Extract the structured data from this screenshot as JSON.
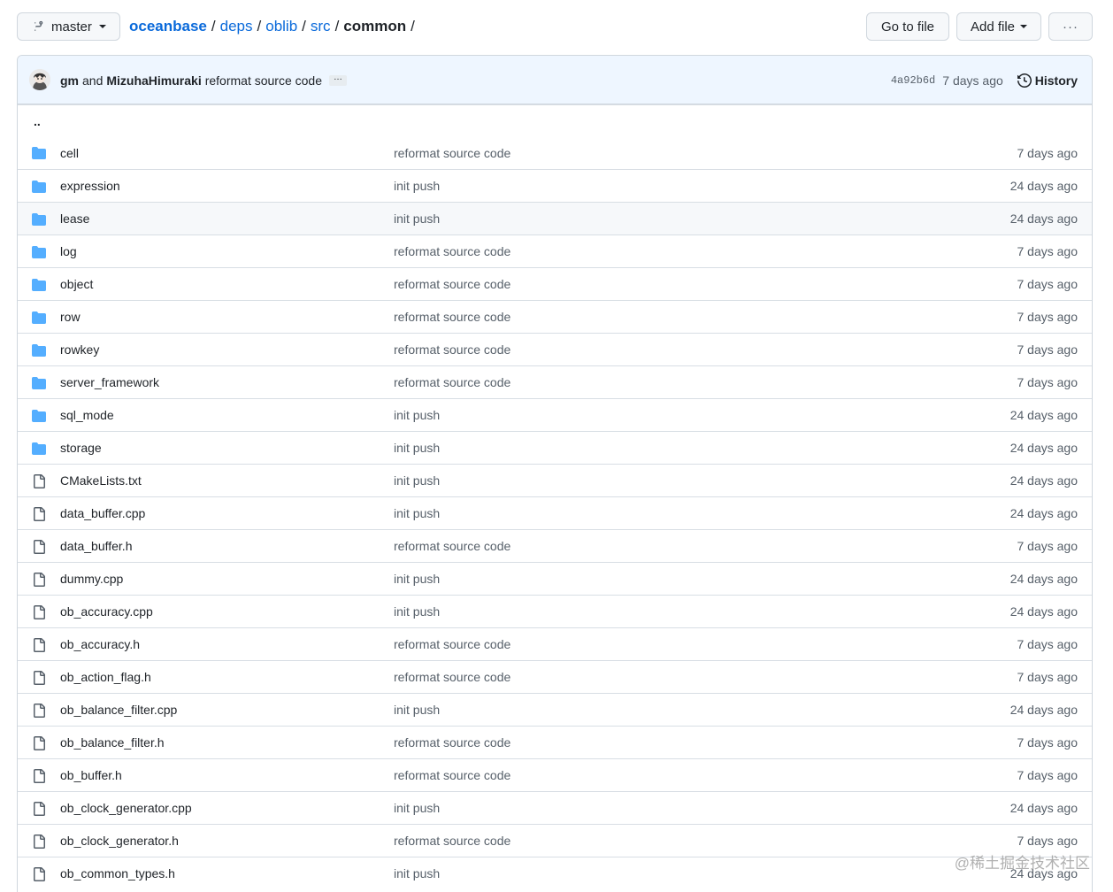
{
  "toolbar": {
    "branch": "master",
    "breadcrumb": {
      "repo": "oceanbase",
      "parts": [
        "deps",
        "oblib",
        "src"
      ],
      "current": "common",
      "sep": "/"
    },
    "goto_label": "Go to file",
    "addfile_label": "Add file",
    "more_label": "···"
  },
  "commit": {
    "author1": "gm",
    "and": "and",
    "author2": "MizuhaHimuraki",
    "message": "reformat source code",
    "ellipsis": "…",
    "sha": "4a92b6d",
    "age": "7 days ago",
    "history_label": "History"
  },
  "parent_dir": "..",
  "files": [
    {
      "name": "cell",
      "type": "dir",
      "msg": "reformat source code",
      "age": "7 days ago"
    },
    {
      "name": "expression",
      "type": "dir",
      "msg": "init push",
      "age": "24 days ago"
    },
    {
      "name": "lease",
      "type": "dir",
      "msg": "init push",
      "age": "24 days ago"
    },
    {
      "name": "log",
      "type": "dir",
      "msg": "reformat source code",
      "age": "7 days ago"
    },
    {
      "name": "object",
      "type": "dir",
      "msg": "reformat source code",
      "age": "7 days ago"
    },
    {
      "name": "row",
      "type": "dir",
      "msg": "reformat source code",
      "age": "7 days ago"
    },
    {
      "name": "rowkey",
      "type": "dir",
      "msg": "reformat source code",
      "age": "7 days ago"
    },
    {
      "name": "server_framework",
      "type": "dir",
      "msg": "reformat source code",
      "age": "7 days ago"
    },
    {
      "name": "sql_mode",
      "type": "dir",
      "msg": "init push",
      "age": "24 days ago"
    },
    {
      "name": "storage",
      "type": "dir",
      "msg": "init push",
      "age": "24 days ago"
    },
    {
      "name": "CMakeLists.txt",
      "type": "file",
      "msg": "init push",
      "age": "24 days ago"
    },
    {
      "name": "data_buffer.cpp",
      "type": "file",
      "msg": "init push",
      "age": "24 days ago"
    },
    {
      "name": "data_buffer.h",
      "type": "file",
      "msg": "reformat source code",
      "age": "7 days ago"
    },
    {
      "name": "dummy.cpp",
      "type": "file",
      "msg": "init push",
      "age": "24 days ago"
    },
    {
      "name": "ob_accuracy.cpp",
      "type": "file",
      "msg": "init push",
      "age": "24 days ago"
    },
    {
      "name": "ob_accuracy.h",
      "type": "file",
      "msg": "reformat source code",
      "age": "7 days ago"
    },
    {
      "name": "ob_action_flag.h",
      "type": "file",
      "msg": "reformat source code",
      "age": "7 days ago"
    },
    {
      "name": "ob_balance_filter.cpp",
      "type": "file",
      "msg": "init push",
      "age": "24 days ago"
    },
    {
      "name": "ob_balance_filter.h",
      "type": "file",
      "msg": "reformat source code",
      "age": "7 days ago"
    },
    {
      "name": "ob_buffer.h",
      "type": "file",
      "msg": "reformat source code",
      "age": "7 days ago"
    },
    {
      "name": "ob_clock_generator.cpp",
      "type": "file",
      "msg": "init push",
      "age": "24 days ago"
    },
    {
      "name": "ob_clock_generator.h",
      "type": "file",
      "msg": "reformat source code",
      "age": "7 days ago"
    },
    {
      "name": "ob_common_types.h",
      "type": "file",
      "msg": "init push",
      "age": "24 days ago"
    }
  ],
  "watermark": "@稀土掘金技术社区",
  "colors": {
    "folder": "#54aeff",
    "link": "#0969da",
    "header_bg": "#eef6ff"
  }
}
